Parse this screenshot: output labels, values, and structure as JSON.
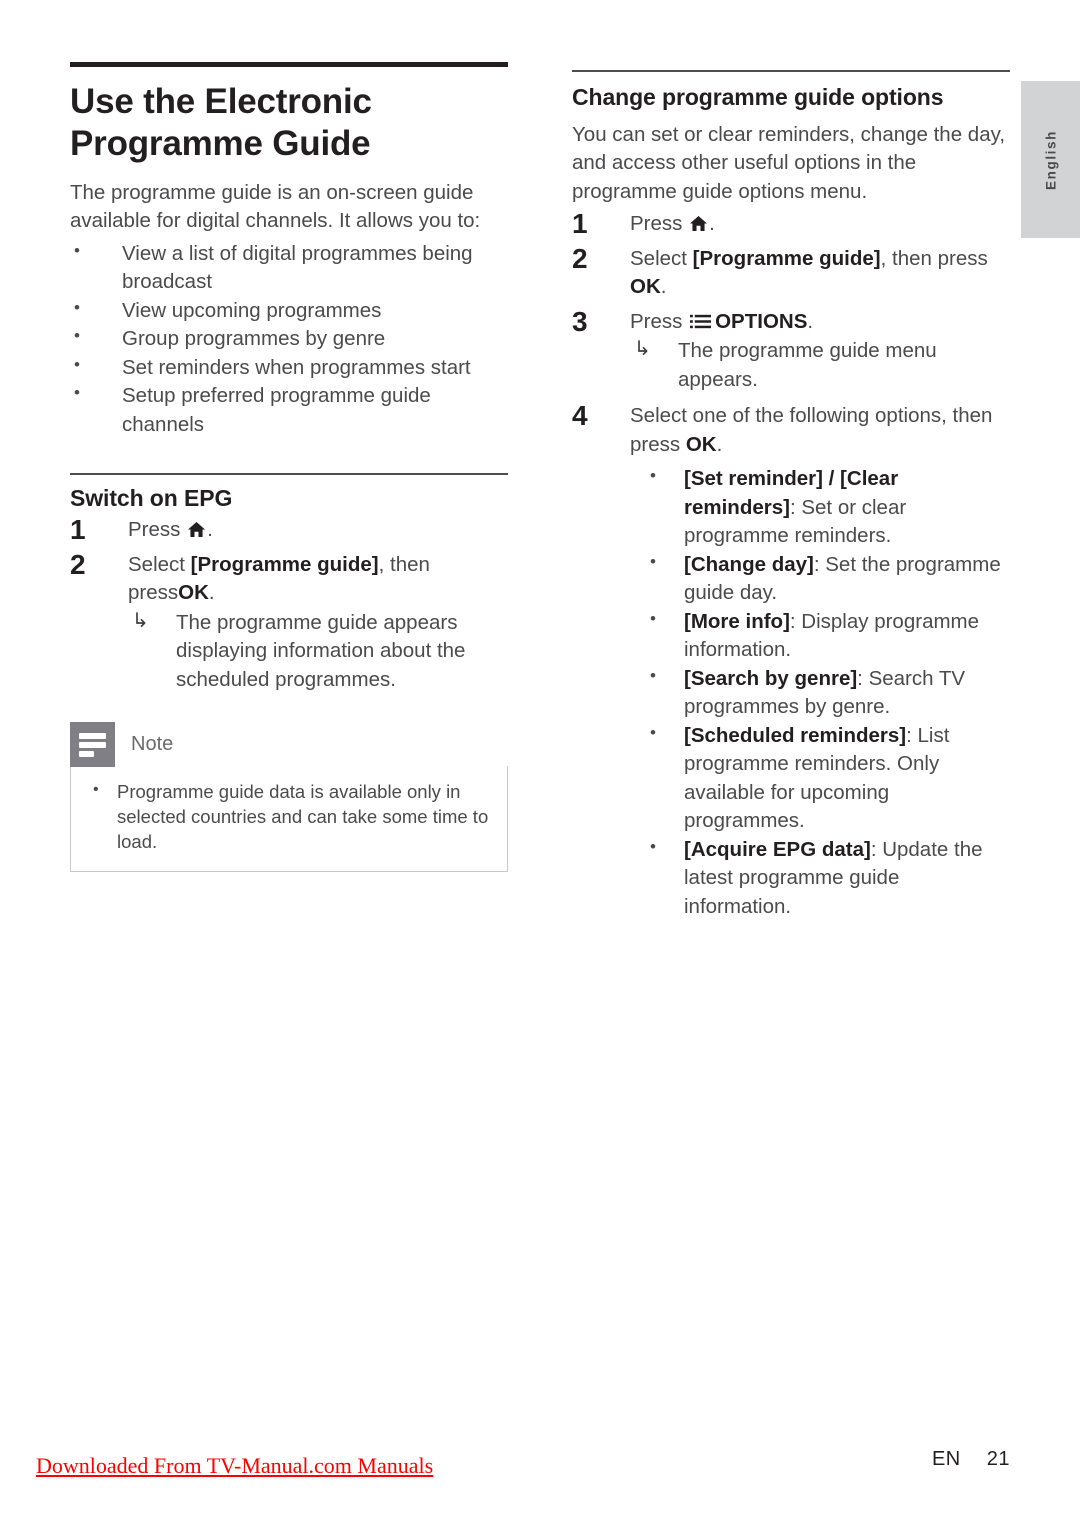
{
  "language_tab": "English",
  "left_column": {
    "title": "Use the Electronic Programme Guide",
    "intro": "The programme guide is an on-screen guide available for digital channels. It allows you to:",
    "features": [
      "View a list of digital programmes being broadcast",
      "View upcoming programmes",
      "Group programmes by genre",
      "Set reminders when programmes start",
      "Setup preferred programme guide channels"
    ],
    "section": {
      "heading": "Switch on EPG",
      "steps": [
        {
          "num": "1",
          "pre": "Press ",
          "icon": "home-icon",
          "post": "."
        },
        {
          "num": "2",
          "pre": "Select ",
          "bold": "[Programme guide]",
          "mid": ", then press",
          "bold2": "OK",
          "post": "."
        }
      ],
      "result": "The programme guide appears displaying information about the scheduled programmes."
    },
    "note": {
      "title": "Note",
      "items": [
        "Programme guide data is available only in selected countries and can take some time to load."
      ]
    }
  },
  "right_column": {
    "heading": "Change programme guide options",
    "intro": "You can set or clear reminders, change the day, and access other useful options in the programme guide options menu.",
    "steps": [
      {
        "num": "1",
        "pre": "Press ",
        "icon": "home-icon",
        "post": "."
      },
      {
        "num": "2",
        "pre": "Select ",
        "bold": "[Programme guide]",
        "mid": ", then press ",
        "bold2": "OK",
        "post": "."
      },
      {
        "num": "3",
        "pre": "Press ",
        "icon": "options-icon",
        "bold2": "OPTIONS",
        "post": "."
      },
      {
        "num": "4",
        "pre": "Select one of the following options, then press ",
        "bold2": "OK",
        "post": "."
      }
    ],
    "step3_result": "The programme guide menu appears.",
    "options": [
      {
        "label": "[Set reminder] / [Clear reminders]",
        "desc": ": Set or clear programme reminders."
      },
      {
        "label": "[Change day]",
        "desc": ": Set the programme guide day."
      },
      {
        "label": "[More info]",
        "desc": ": Display programme information."
      },
      {
        "label": "[Search by genre]",
        "desc": ": Search TV programmes by genre."
      },
      {
        "label": "[Scheduled reminders]",
        "desc": ": List programme reminders. Only available for upcoming programmes."
      },
      {
        "label": "[Acquire EPG data]",
        "desc": ": Update the latest programme guide information."
      }
    ]
  },
  "footer": {
    "link": "Downloaded From TV-Manual.com Manuals",
    "lang_code": "EN",
    "page_number": "21"
  },
  "colors": {
    "rule": "#231f20",
    "note_badge": "#807f85",
    "lang_tab": "#d2d3d5",
    "footer_link": "#ff0000"
  }
}
